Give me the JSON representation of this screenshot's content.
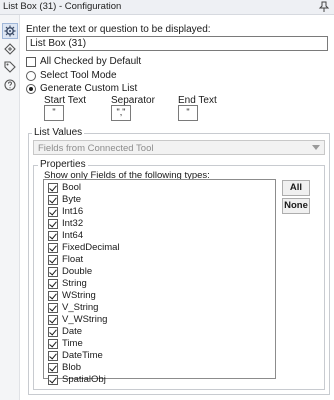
{
  "window": {
    "title": "List Box (31) - Configuration"
  },
  "toolstrip": {
    "items": [
      {
        "icon": "gear-icon",
        "active": true
      },
      {
        "icon": "connection-icon",
        "active": false
      },
      {
        "icon": "tag-icon",
        "active": false
      },
      {
        "icon": "help-icon",
        "active": false
      }
    ]
  },
  "prompt": {
    "label": "Enter the text or question to be displayed:",
    "value": "List Box (31)"
  },
  "all_checked_default": {
    "label": "All Checked by Default",
    "checked": false
  },
  "mode": {
    "select_tool": {
      "label": "Select Tool Mode",
      "selected": false
    },
    "custom_list": {
      "label": "Generate Custom List",
      "selected": true
    }
  },
  "custom_list": {
    "start_text": {
      "label": "Start Text",
      "value": "\""
    },
    "separator": {
      "label": "Separator",
      "value": "\",\""
    },
    "end_text": {
      "label": "End Text",
      "value": "\""
    }
  },
  "list_values": {
    "title": "List Values",
    "source_select": "Fields from Connected Tool",
    "properties": {
      "title": "Properties",
      "filter_label": "Show only Fields of the following types:",
      "types": [
        "Bool",
        "Byte",
        "Int16",
        "Int32",
        "Int64",
        "FixedDecimal",
        "Float",
        "Double",
        "String",
        "WString",
        "V_String",
        "V_WString",
        "Date",
        "Time",
        "DateTime",
        "Blob",
        "SpatialObj"
      ],
      "all_button": "All",
      "none_button": "None"
    }
  }
}
